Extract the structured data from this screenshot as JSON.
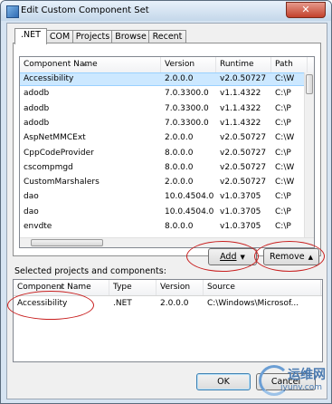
{
  "window": {
    "title": "Edit Custom Component Set",
    "close_glyph": "✕"
  },
  "tabs": [
    ".NET",
    "COM",
    "Projects",
    "Browse",
    "Recent"
  ],
  "top_list": {
    "columns": [
      "Component Name",
      "Version",
      "Runtime",
      "Path"
    ],
    "rows": [
      [
        "Accessibility",
        "2.0.0.0",
        "v2.0.50727",
        "C:\\W"
      ],
      [
        "adodb",
        "7.0.3300.0",
        "v1.1.4322",
        "C:\\P"
      ],
      [
        "adodb",
        "7.0.3300.0",
        "v1.1.4322",
        "C:\\P"
      ],
      [
        "adodb",
        "7.0.3300.0",
        "v1.1.4322",
        "C:\\P"
      ],
      [
        "AspNetMMCExt",
        "2.0.0.0",
        "v2.0.50727",
        "C:\\W"
      ],
      [
        "CppCodeProvider",
        "8.0.0.0",
        "v2.0.50727",
        "C:\\P"
      ],
      [
        "cscompmgd",
        "8.0.0.0",
        "v2.0.50727",
        "C:\\W"
      ],
      [
        "CustomMarshalers",
        "2.0.0.0",
        "v2.0.50727",
        "C:\\W"
      ],
      [
        "dao",
        "10.0.4504.0",
        "v1.0.3705",
        "C:\\P"
      ],
      [
        "dao",
        "10.0.4504.0",
        "v1.0.3705",
        "C:\\P"
      ],
      [
        "envdte",
        "8.0.0.0",
        "v1.0.3705",
        "C:\\P"
      ]
    ]
  },
  "buttons": {
    "add": "Add",
    "remove": "Remove",
    "ok": "OK",
    "cancel": "Cancel"
  },
  "selected_label": "Selected projects and components:",
  "bottom_list": {
    "columns": [
      "Component Name",
      "Type",
      "Version",
      "Source"
    ],
    "rows": [
      [
        "Accessibility",
        ".NET",
        "2.0.0.0",
        "C:\\Windows\\Microsof..."
      ]
    ]
  },
  "watermark": {
    "brand": "运维网",
    "site": "iyunv.com"
  },
  "colors": {
    "annotation": "#c81e1e",
    "selection": "#cce8ff"
  }
}
